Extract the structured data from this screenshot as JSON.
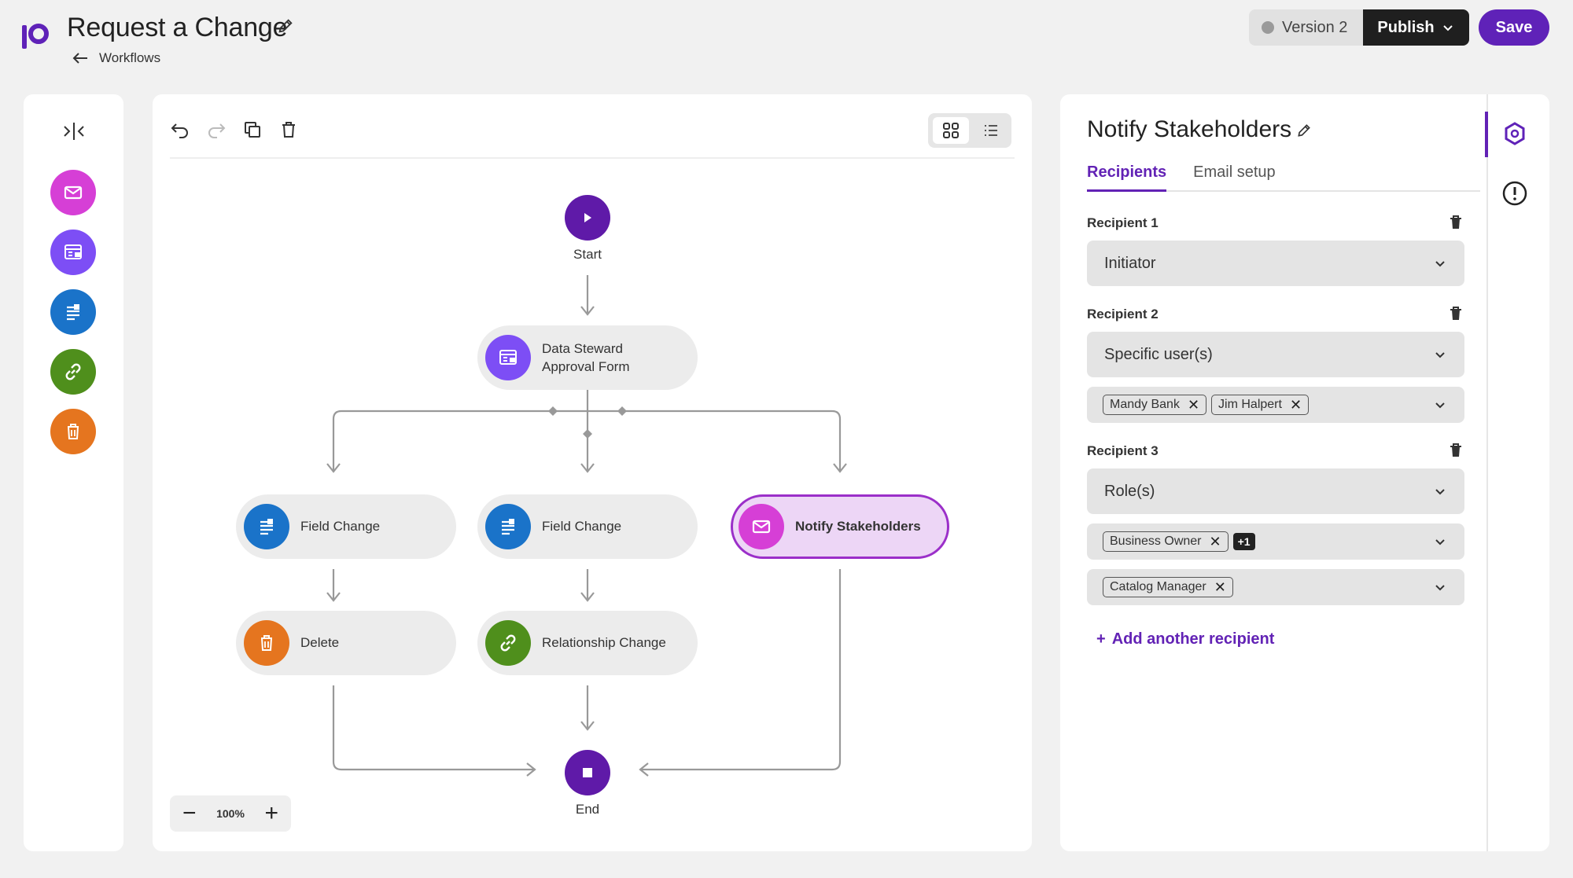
{
  "header": {
    "title": "Request a Change",
    "back_label": "Workflows",
    "version_label": "Version 2",
    "publish_label": "Publish",
    "save_label": "Save"
  },
  "palette": {
    "items": [
      {
        "icon": "mail-icon",
        "color": "#d63fd6"
      },
      {
        "icon": "form-icon",
        "color": "#7d4ef5"
      },
      {
        "icon": "field-change-icon",
        "color": "#1a73c9"
      },
      {
        "icon": "link-icon",
        "color": "#4f8f1c"
      },
      {
        "icon": "trash-icon",
        "color": "#e5751f"
      }
    ]
  },
  "canvas": {
    "zoom_label": "100%",
    "nodes": {
      "start": "Start",
      "approval_line1": "Data Steward",
      "approval_line2": "Approval Form",
      "field_change_1": "Field Change",
      "field_change_2": "Field Change",
      "notify": "Notify Stakeholders",
      "delete": "Delete",
      "relationship": "Relationship Change",
      "end": "End"
    }
  },
  "props": {
    "title": "Notify Stakeholders",
    "tabs": [
      "Recipients",
      "Email setup"
    ],
    "recipient1": {
      "label": "Recipient 1",
      "value": "Initiator"
    },
    "recipient2": {
      "label": "Recipient 2",
      "value": "Specific user(s)",
      "chips": [
        "Mandy Bank",
        "Jim Halpert"
      ]
    },
    "recipient3": {
      "label": "Recipient 3",
      "value": "Role(s)",
      "chips_a": [
        "Business Owner"
      ],
      "more": "+1",
      "chips_b": [
        "Catalog Manager"
      ]
    },
    "add_label": "Add another recipient"
  },
  "colors": {
    "accent": "#5f22b8",
    "selected_node": "#edd6f6"
  }
}
